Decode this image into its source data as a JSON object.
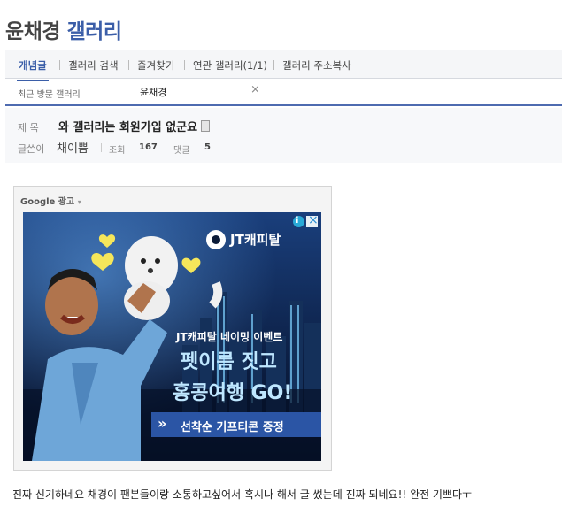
{
  "header": {
    "name": "윤채경",
    "gallery": "갤러리"
  },
  "tabs": [
    "개념글",
    "갤러리 검색",
    "즐겨찾기",
    "연관 갤러리(1/1)",
    "갤러리 주소복사"
  ],
  "recent": {
    "label": "최근 방문 갤러리",
    "item": "윤채경",
    "close": "×"
  },
  "post": {
    "subject_label": "제 목",
    "subject": "와 갤러리는 회원가입 없군요",
    "author_label": "글쓴이",
    "author": "채이쁨",
    "views_label": "조회",
    "views": "167",
    "comments_label": "댓글",
    "comments": "5"
  },
  "ad": {
    "label": "Google 광고",
    "caret": "▾",
    "brand": "JT캐피탈",
    "event": "JT캐피탈 네이밍 이벤트",
    "headline1": "펫이름 짓고",
    "headline2": "홍콩여행 GO!",
    "cta": "선착순 기프티콘 증정",
    "cta_arrow": "»",
    "info": "i",
    "close": "×"
  },
  "content": {
    "text": "진짜 신기하네요 채경이 팬분들이랑 소통하고싶어서 혹시나 해서 글 썼는데 진짜 되네요!! 완전 기쁘다ㅜ"
  },
  "colors": {
    "accent": "#3b5ea8",
    "banner_bg": "#0b1a36",
    "cta_bg": "#2b55a5",
    "headline": "#bfe7ff"
  }
}
